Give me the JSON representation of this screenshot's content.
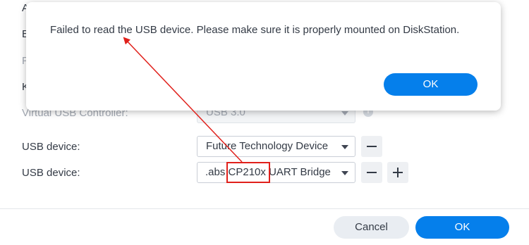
{
  "background_form": {
    "cutoff_labels": [
      "A",
      "B",
      "F",
      "K"
    ],
    "virtual_usb_controller": {
      "label": "Virtual USB Controller:",
      "value": "USB 3.0"
    },
    "usb_devices": [
      {
        "label": "USB device:",
        "value": "Future Technology Device"
      },
      {
        "label": "USB device:",
        "value_prefix": ".abs ",
        "value_highlight": "CP210x",
        "value_suffix": " UART Bridge"
      }
    ]
  },
  "footer": {
    "cancel_label": "Cancel",
    "ok_label": "OK"
  },
  "dialog": {
    "message": "Failed to read the USB device. Please make sure it is properly mounted on DiskStation.",
    "ok_label": "OK"
  },
  "colors": {
    "primary": "#057feb",
    "annotation": "#e0201b"
  }
}
